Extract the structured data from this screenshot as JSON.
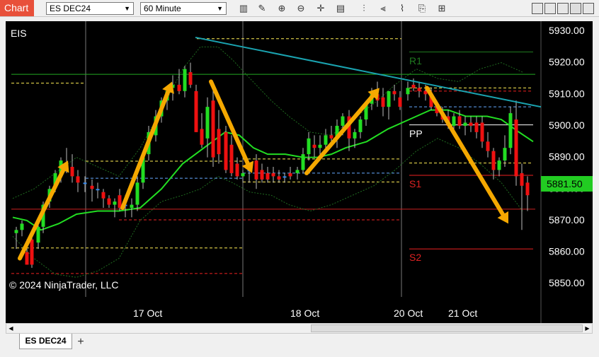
{
  "toolbar": {
    "chart_tab": "Chart",
    "instrument": "ES DEC24",
    "interval": "60 Minute"
  },
  "chart": {
    "instrument_label": "EIS",
    "copyright": "© 2024 NinjaTrader, LLC",
    "price_axis": [
      "5930.00",
      "5920.00",
      "5910.00",
      "5900.00",
      "5890.00",
      "5880.00",
      "5870.00",
      "5860.00",
      "5850.00"
    ],
    "time_axis": [
      "17 Oct",
      "18 Oct",
      "20 Oct",
      "21 Oct"
    ],
    "current_price": "5881.50",
    "pivot_labels": {
      "r1": "R1",
      "pp": "PP",
      "s1": "S1",
      "s2": "S2"
    },
    "colors": {
      "up_candle": "#22dd22",
      "down_candle": "#ee1111",
      "neutral_candle": "#3388ee",
      "ma": "#22dd22",
      "trendline": "#1aa3b0",
      "arrow": "#f5a800",
      "price_marker": "#22cc22"
    }
  },
  "tabs": {
    "active": "ES DEC24",
    "add": "+"
  }
}
